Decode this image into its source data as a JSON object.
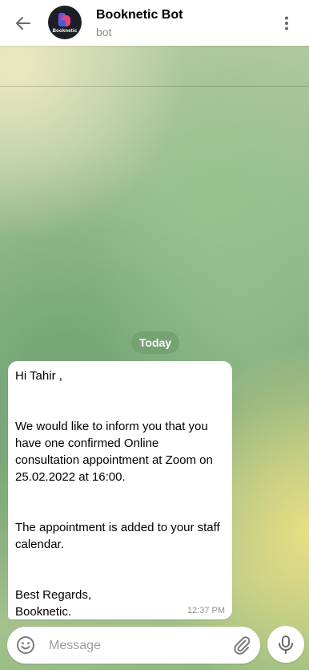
{
  "header": {
    "title": "Booknetic Bot",
    "subtitle": "bot",
    "avatar_text": "Booknetic"
  },
  "chat": {
    "date_label": "Today",
    "message": {
      "lines": [
        "Hi Tahir ,",
        "We would like to inform you that you have one confirmed Online consultation appointment at Zoom on 25.02.2022 at 16:00.",
        "The appointment is added to your staff calendar.",
        "Best Regards,",
        "Booknetic."
      ],
      "time": "12:37 PM"
    }
  },
  "composer": {
    "placeholder": "Message"
  },
  "icons": {
    "back": "arrow-left-icon",
    "menu": "more-vertical-icon",
    "emoji": "smile-icon",
    "attach": "paperclip-icon",
    "mic": "microphone-icon"
  },
  "colors": {
    "date_pill": "#74a070",
    "bubble": "#ffffff",
    "logo_pink": "#e8457b",
    "logo_purple": "#7b4dd6"
  }
}
